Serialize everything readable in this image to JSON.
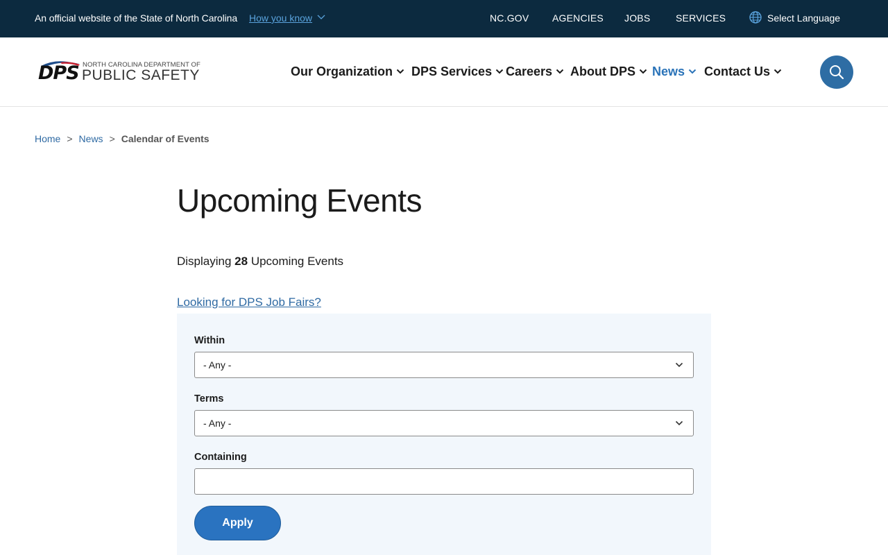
{
  "banner": {
    "official_text": "An official website of the State of North Carolina",
    "how_you_know": "How you know",
    "links": [
      "NC.GOV",
      "AGENCIES",
      "JOBS",
      "SERVICES"
    ],
    "select_language": "Select Language"
  },
  "logo": {
    "abbr": "DPS",
    "line1": "NORTH CAROLINA DEPARTMENT OF",
    "line2": "PUBLIC SAFETY"
  },
  "nav": {
    "items": [
      {
        "label": "Our Organization",
        "active": false
      },
      {
        "label": "DPS Services",
        "active": false
      },
      {
        "label": "Careers",
        "active": false
      },
      {
        "label": "About DPS",
        "active": false
      },
      {
        "label": "News",
        "active": true
      },
      {
        "label": "Contact Us",
        "active": false
      }
    ]
  },
  "breadcrumb": {
    "home": "Home",
    "news": "News",
    "separator": ">",
    "current": "Calendar of Events"
  },
  "main": {
    "title": "Upcoming Events",
    "displaying_prefix": "Displaying",
    "count": "28",
    "displaying_suffix": "Upcoming Events",
    "job_fairs_link": "Looking for DPS Job Fairs?"
  },
  "filters": {
    "within_label": "Within",
    "within_value": "- Any -",
    "terms_label": "Terms",
    "terms_value": "- Any -",
    "containing_label": "Containing",
    "containing_value": "",
    "apply_label": "Apply"
  },
  "colors": {
    "banner_bg": "#0c2a3f",
    "accent": "#2a73c0",
    "link": "#2f6aa3",
    "panel_bg": "#f2f7fc"
  }
}
